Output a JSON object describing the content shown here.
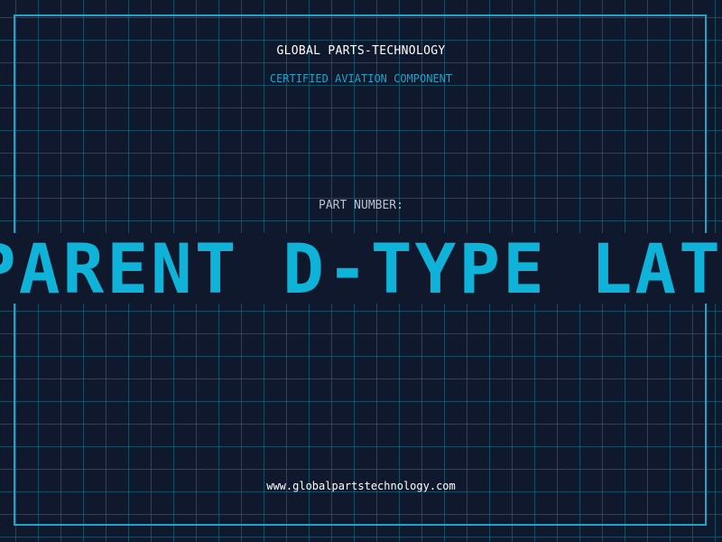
{
  "header": {
    "company": "GLOBAL PARTS-TECHNOLOGY",
    "subtitle": "CERTIFIED AVIATION COMPONENT"
  },
  "part": {
    "label": "PART NUMBER:",
    "value": "PARENT D-TYPE LATC"
  },
  "footer": {
    "url": "www.globalpartstechnology.com"
  },
  "colors": {
    "background": "#0f182c",
    "accent": "#1fa3c9",
    "part_number": "#0fb2d8",
    "grid": "#18788c"
  }
}
